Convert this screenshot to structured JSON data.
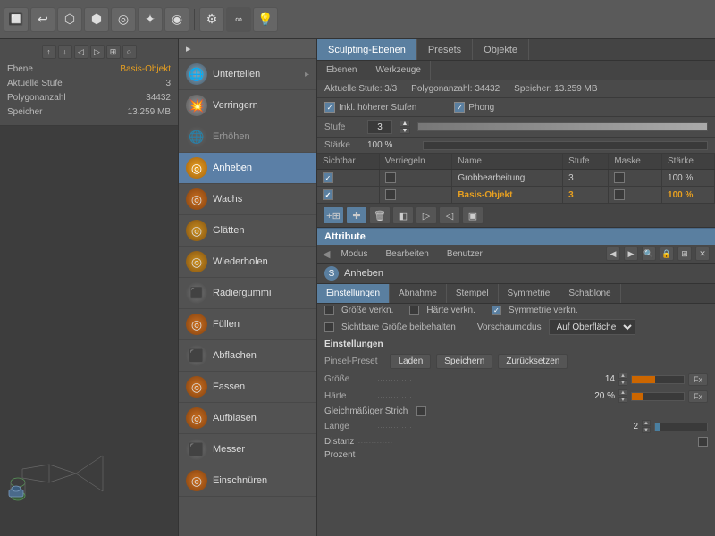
{
  "toolbar": {
    "icons": [
      "🔲",
      "↩",
      "⬡",
      "⬢",
      "🔵",
      "✦",
      "◉",
      "⚙",
      "💡"
    ],
    "view_controls": [
      "↑",
      "↓",
      "◁",
      "▷",
      "⊞",
      "○"
    ]
  },
  "left_panel": {
    "info": {
      "ebene_label": "Ebene",
      "ebene_value": "Basis-Objekt",
      "aktuelle_stufe_label": "Aktuelle Stufe",
      "aktuelle_stufe_value": "3",
      "polygonanzahl_label": "Polygonanzahl",
      "polygonanzahl_value": "34432",
      "speicher_label": "Speicher",
      "speicher_value": "13.259 MB"
    }
  },
  "tool_menu": {
    "header_label": "▸",
    "items": [
      {
        "id": "unterteilen",
        "label": "Unterteilen",
        "icon": "🌐",
        "color": "#777",
        "active": false,
        "disabled": false
      },
      {
        "id": "verringern",
        "label": "Verringern",
        "icon": "💣",
        "color": "#888",
        "active": false,
        "disabled": false
      },
      {
        "id": "erhoehen",
        "label": "Erhöhen",
        "icon": "🌐",
        "color": "#888",
        "active": false,
        "disabled": true
      },
      {
        "id": "anheben",
        "label": "Anheben",
        "icon": "🟠",
        "color": "#e8a020",
        "active": true,
        "disabled": false
      },
      {
        "id": "wachs",
        "label": "Wachs",
        "icon": "🟠",
        "color": "#cc6600",
        "active": false,
        "disabled": false
      },
      {
        "id": "glaetten",
        "label": "Glätten",
        "icon": "🟠",
        "color": "#cc8800",
        "active": false,
        "disabled": false
      },
      {
        "id": "wiederholen",
        "label": "Wiederholen",
        "icon": "🟠",
        "color": "#cc8800",
        "active": false,
        "disabled": false
      },
      {
        "id": "radiergummi",
        "label": "Radiergummi",
        "icon": "⬛",
        "color": "#555",
        "active": false,
        "disabled": false
      },
      {
        "id": "fuellen",
        "label": "Füllen",
        "icon": "🟠",
        "color": "#cc6600",
        "active": false,
        "disabled": false
      },
      {
        "id": "abflachen",
        "label": "Abflachen",
        "icon": "⬛",
        "color": "#555",
        "active": false,
        "disabled": false
      },
      {
        "id": "fassen",
        "label": "Fassen",
        "icon": "🟠",
        "color": "#cc6600",
        "active": false,
        "disabled": false
      },
      {
        "id": "aufblasen",
        "label": "Aufblasen",
        "icon": "🟠",
        "color": "#cc6600",
        "active": false,
        "disabled": false
      },
      {
        "id": "messer",
        "label": "Messer",
        "icon": "⬛",
        "color": "#555",
        "active": false,
        "disabled": false
      },
      {
        "id": "einschnueren",
        "label": "Einschnüren",
        "icon": "🟠",
        "color": "#cc6600",
        "active": false,
        "disabled": false
      }
    ]
  },
  "right_panel": {
    "main_tabs": [
      {
        "id": "sculpting-ebenen",
        "label": "Sculpting-Ebenen",
        "active": true
      },
      {
        "id": "presets",
        "label": "Presets",
        "active": false
      },
      {
        "id": "objekte",
        "label": "Objekte",
        "active": false
      }
    ],
    "sub_tabs": [
      {
        "id": "ebenen",
        "label": "Ebenen",
        "active": false
      },
      {
        "id": "werkzeuge",
        "label": "Werkzeuge",
        "active": false
      }
    ],
    "info_bar": {
      "aktuelle_stufe": "Aktuelle Stufe: 3/3",
      "polygonanzahl": "Polygonanzahl: 34432",
      "speicher": "Speicher: 13.259 MB"
    },
    "options": {
      "inkl_hoehere": "Inkl. höherer Stufen",
      "inkl_checked": true,
      "phong": "Phong",
      "phong_checked": true
    },
    "stufe": {
      "label": "Stufe",
      "value": "3",
      "bar_percent": 100
    },
    "staerke": {
      "label": "Stärke",
      "value": "100 %",
      "bar_percent": 100
    },
    "layer_table": {
      "headers": [
        "Sichtbar",
        "Verriegeln",
        "Name",
        "Stufe",
        "Maske",
        "Stärke"
      ],
      "rows": [
        {
          "sichtbar": true,
          "verriegeln": false,
          "name": "Grobbearbeitung",
          "stufe": "3",
          "maske": false,
          "staerke": "100 %",
          "active": false
        },
        {
          "sichtbar": true,
          "verriegeln": false,
          "name": "Basis-Objekt",
          "stufe": "3",
          "maske": false,
          "staerke": "100 %",
          "active": true
        }
      ]
    },
    "layer_toolbar_buttons": [
      "+▣",
      "✚",
      "🗑",
      "◧",
      "▣▷",
      "▣◁",
      "▣"
    ],
    "attribute_label": "Attribute",
    "mode_bar": {
      "prefix_icon": "◀",
      "items": [
        "Modus",
        "Bearbeiten",
        "Benutzer"
      ],
      "right_icons": [
        "◀",
        "▶",
        "🔍",
        "🔒",
        "⊞",
        "✕"
      ]
    },
    "anheben_section": {
      "icon_label": "S",
      "title": "Anheben"
    },
    "brush_tabs": [
      {
        "id": "einstellungen",
        "label": "Einstellungen",
        "active": true
      },
      {
        "id": "abnahme",
        "label": "Abnahme",
        "active": false
      },
      {
        "id": "stempel",
        "label": "Stempel",
        "active": false
      },
      {
        "id": "symmetrie",
        "label": "Symmetrie",
        "active": false
      },
      {
        "id": "schablone",
        "label": "Schablone",
        "active": false
      }
    ],
    "brush_settings": {
      "groesse_verkn": "Größe verkn.",
      "haerte_verkn": "Härte verkn.",
      "symmetrie_verkn": "Symmetrie verkn.",
      "symmetrie_checked": true,
      "sichtbare_groesse": "Sichtbare Größe beibehalten",
      "sichtbare_checked": false,
      "vorschaumodus_label": "Vorschaumodus",
      "vorschaumodus_value": "Auf Oberfläche",
      "einstellungen_heading": "Einstellungen",
      "pinsel_preset_label": "Pinsel-Preset",
      "laden_btn": "Laden",
      "speichern_btn": "Speichern",
      "zuruecksetzen_btn": "Zurücksetzen",
      "groesse_label": "Größe",
      "groesse_value": "14",
      "groesse_bar_percent": 45,
      "haerte_label": "Härte",
      "haerte_value": "20 %",
      "haerte_bar_percent": 20,
      "gleichm_label": "Gleichmäßiger Strich",
      "laenge_label": "Länge",
      "laenge_value": "2",
      "laenge_bar_percent": 10,
      "distanz_label": "Distanz",
      "prozent_label": "Prozent"
    }
  }
}
